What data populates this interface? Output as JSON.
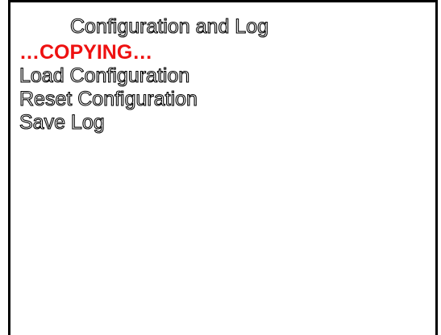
{
  "screen": {
    "title": "Configuration and Log"
  },
  "menu": {
    "items": [
      {
        "label": "…COPYING…",
        "state": "active"
      },
      {
        "label": "Load Configuration",
        "state": "normal"
      },
      {
        "label": "Reset Configuration",
        "state": "normal"
      },
      {
        "label": "Save Log",
        "state": "normal"
      }
    ]
  },
  "colors": {
    "background": "#ffffff",
    "border": "#000000",
    "active_text": "#ee1111",
    "normal_text_fill": "#ffffff",
    "normal_text_outline": "#000000"
  }
}
